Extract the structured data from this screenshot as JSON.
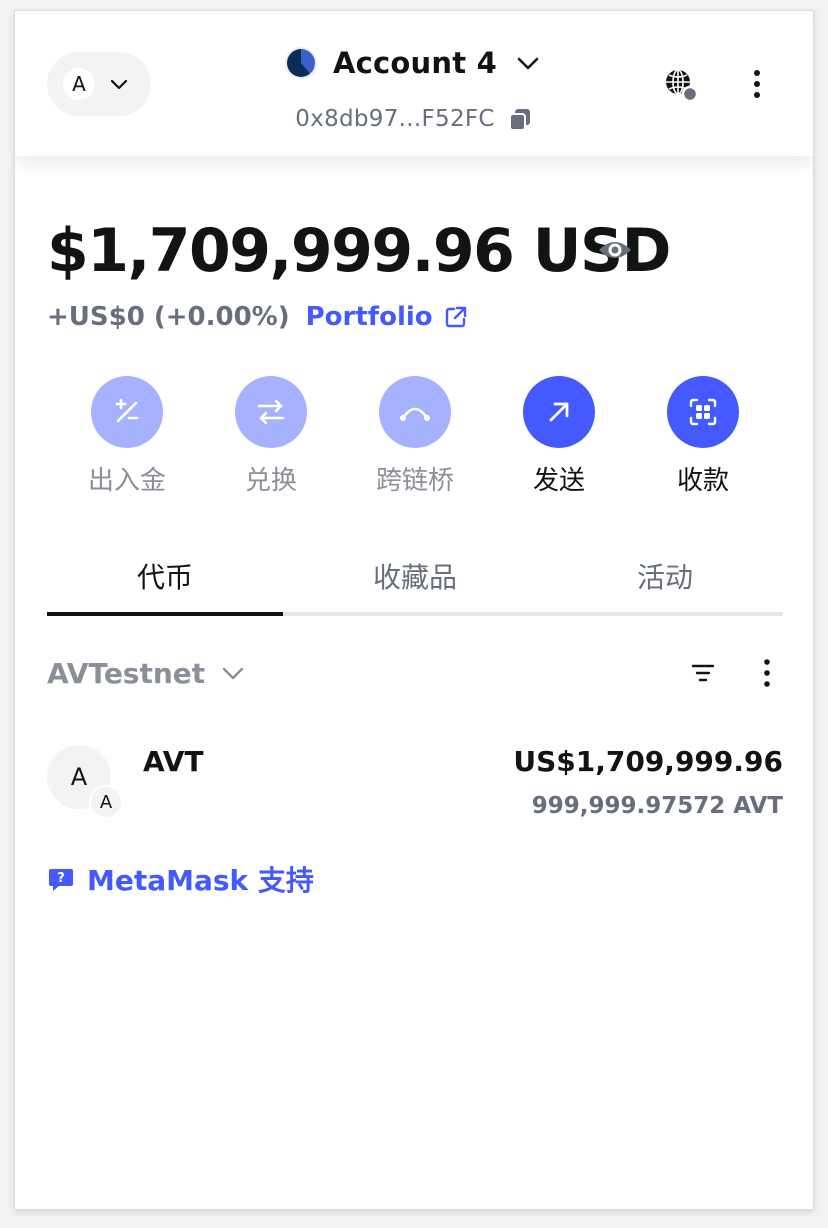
{
  "header": {
    "network_avatar_letter": "A",
    "account_name": "Account 4",
    "address": "0x8db97...F52FC"
  },
  "balance": {
    "amount": "$1,709,999.96 USD",
    "change": "+US$0 (+0.00%)",
    "portfolio_label": "Portfolio"
  },
  "actions": [
    {
      "label": "出入金",
      "icon": "buy-sell-icon",
      "style": "light"
    },
    {
      "label": "兑换",
      "icon": "swap-icon",
      "style": "light"
    },
    {
      "label": "跨链桥",
      "icon": "bridge-icon",
      "style": "light"
    },
    {
      "label": "发送",
      "icon": "send-arrow-icon",
      "style": "dark"
    },
    {
      "label": "收款",
      "icon": "qr-receive-icon",
      "style": "dark"
    }
  ],
  "tabs": [
    {
      "label": "代币",
      "active": true
    },
    {
      "label": "收藏品",
      "active": false
    },
    {
      "label": "活动",
      "active": false
    }
  ],
  "token_list": {
    "network_filter": "AVTestnet",
    "tokens": [
      {
        "avatar_letter": "A",
        "badge_letter": "A",
        "name": "AVT",
        "fiat": "US$1,709,999.96",
        "amount": "999,999.97572 AVT"
      }
    ]
  },
  "support_label": "MetaMask 支持",
  "colors": {
    "accent": "#4459ff",
    "accent_light": "#a7b2ff",
    "muted_text": "#686e7d",
    "text": "#121314"
  }
}
